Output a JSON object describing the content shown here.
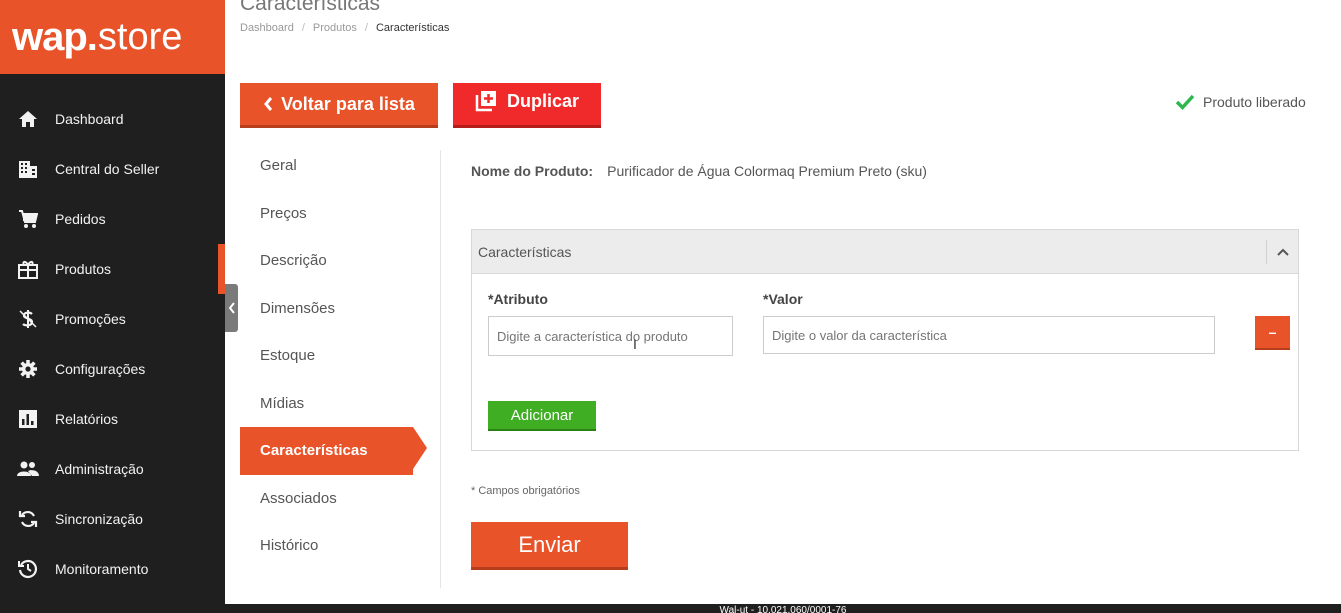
{
  "app": {
    "logo_wap": "wap",
    "logo_store": "store"
  },
  "sidebar": {
    "items": [
      {
        "label": "Dashboard",
        "icon": "home-icon"
      },
      {
        "label": "Central do Seller",
        "icon": "building-icon"
      },
      {
        "label": "Pedidos",
        "icon": "cart-icon"
      },
      {
        "label": "Produtos",
        "icon": "gift-box-icon",
        "active": true
      },
      {
        "label": "Promoções",
        "icon": "dollar-icon"
      },
      {
        "label": "Configurações",
        "icon": "gear-icon"
      },
      {
        "label": "Relatórios",
        "icon": "chart-icon"
      },
      {
        "label": "Administração",
        "icon": "users-icon"
      },
      {
        "label": "Sincronização",
        "icon": "sync-icon"
      },
      {
        "label": "Monitoramento",
        "icon": "clock-icon"
      }
    ]
  },
  "header": {
    "title": "Características",
    "breadcrumb": [
      "Dashboard",
      "Produtos",
      "Características"
    ]
  },
  "actions": {
    "back_label": "Voltar para lista",
    "duplicate_label": "Duplicar",
    "status_label": "Produto liberado"
  },
  "tabs": [
    {
      "label": "Geral"
    },
    {
      "label": "Preços"
    },
    {
      "label": "Descrição"
    },
    {
      "label": "Dimensões"
    },
    {
      "label": "Estoque"
    },
    {
      "label": "Mídias"
    },
    {
      "label": "Características",
      "active": true
    },
    {
      "label": "Associados"
    },
    {
      "label": "Histórico"
    }
  ],
  "product": {
    "name_key": "Nome do Produto:",
    "name_value": "Purificador de Água Colormaq Premium Preto (sku)"
  },
  "panel": {
    "title": "Características",
    "attribute_label": "*Atributo",
    "attribute_placeholder": "Digite a característica do produto",
    "value_label": "*Valor",
    "value_placeholder": "Digite o valor da característica",
    "remove_label": "–",
    "add_label": "Adicionar"
  },
  "form": {
    "required_note": "* Campos obrigatórios",
    "submit_label": "Enviar"
  },
  "footer": {
    "text": "Wal-ut - 10.021.060/0001-76"
  },
  "colors": {
    "brand": "#e8532a",
    "duplicate": "#f02a2a",
    "add": "#3fae23",
    "sidebar": "#1f1f1f",
    "status_ok": "#2db84d"
  }
}
